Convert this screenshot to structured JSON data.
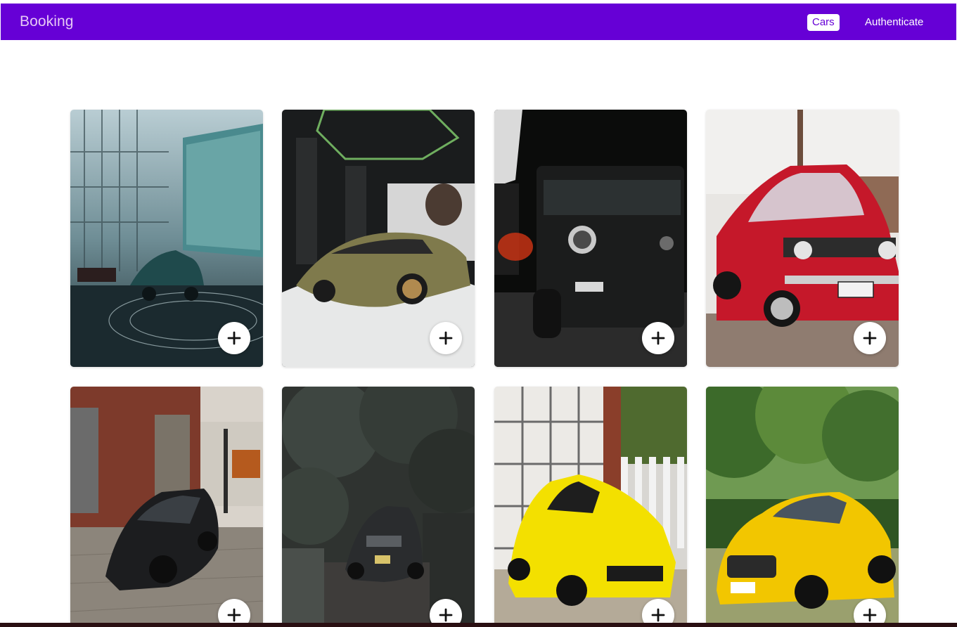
{
  "header": {
    "brand": "Booking",
    "nav": [
      {
        "label": "Cars",
        "active": true
      },
      {
        "label": "Authenticate",
        "active": false
      }
    ],
    "accent_color": "#6600d6"
  },
  "cards": [
    {
      "photo": "teal-bmw-showroom",
      "add_icon": "plus-icon"
    },
    {
      "photo": "olive-lamborghini-showroom",
      "add_icon": "plus-icon"
    },
    {
      "photo": "black-mercedes-g-class-night",
      "add_icon": "plus-icon"
    },
    {
      "photo": "red-ford-mustang-wedding",
      "add_icon": "plus-icon"
    },
    {
      "photo": "black-audi-cobblestone",
      "add_icon": "plus-icon"
    },
    {
      "photo": "dark-audi-r8-garden",
      "add_icon": "plus-icon"
    },
    {
      "photo": "yellow-ferrari-garage",
      "add_icon": "plus-icon"
    },
    {
      "photo": "yellow-mercedes-amg-gt",
      "add_icon": "plus-icon"
    }
  ]
}
